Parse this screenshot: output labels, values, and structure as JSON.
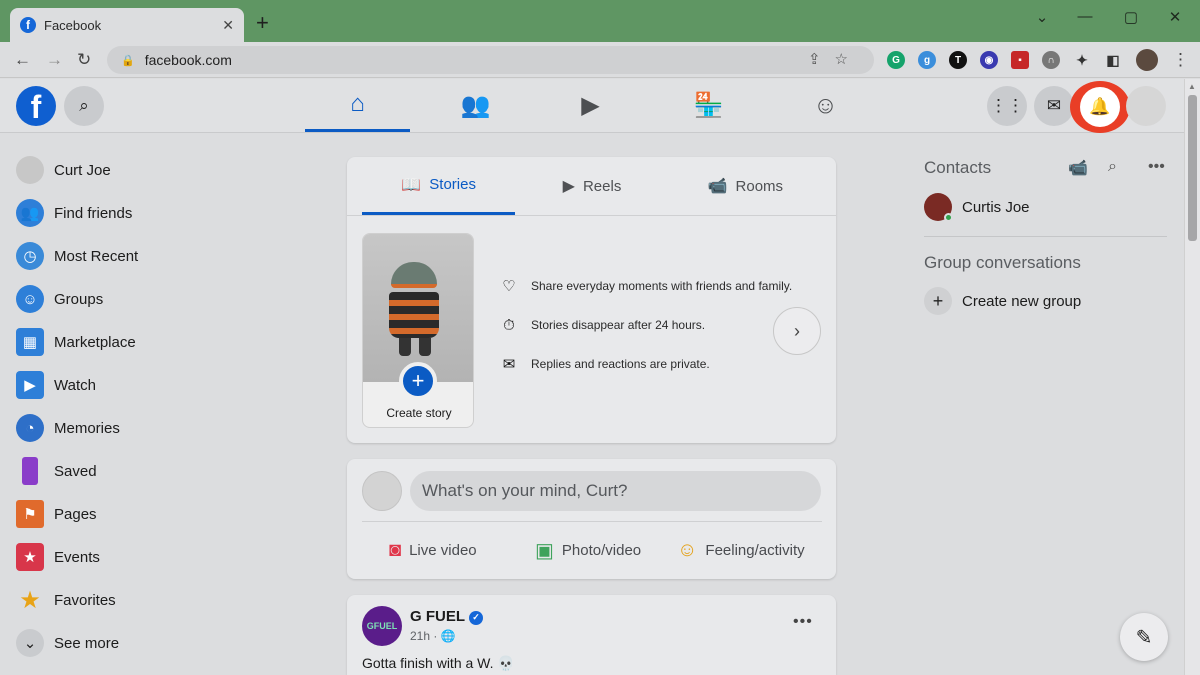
{
  "browser": {
    "tab_title": "Facebook",
    "tab_favicon": "f",
    "tab_close": "✕",
    "new_tab": "+",
    "url": "facebook.com",
    "window_controls": [
      "⌄",
      "—",
      "▢",
      "✕"
    ]
  },
  "header": {
    "logo": "f",
    "icons": {
      "search": "search-icon",
      "home": "home-icon",
      "friends": "friends-icon",
      "watch": "watch-icon",
      "marketplace": "marketplace-icon",
      "groups": "groups-icon",
      "menu": "menu-grid-icon",
      "messenger": "messenger-icon",
      "notifications": "bell-icon",
      "account": "avatar"
    },
    "highlight_color": "#e93e26"
  },
  "left_nav": [
    {
      "label": "Curt Joe",
      "icon": "avatar-icon"
    },
    {
      "label": "Find friends",
      "icon": "friends-icon"
    },
    {
      "label": "Most Recent",
      "icon": "most-recent-icon"
    },
    {
      "label": "Groups",
      "icon": "groups-icon"
    },
    {
      "label": "Marketplace",
      "icon": "marketplace-icon"
    },
    {
      "label": "Watch",
      "icon": "watch-icon"
    },
    {
      "label": "Memories",
      "icon": "memories-icon"
    },
    {
      "label": "Saved",
      "icon": "saved-icon"
    },
    {
      "label": "Pages",
      "icon": "pages-icon"
    },
    {
      "label": "Events",
      "icon": "events-icon"
    },
    {
      "label": "Favorites",
      "icon": "favorites-icon"
    },
    {
      "label": "See more",
      "icon": "chevron-down-icon"
    }
  ],
  "stories": {
    "tabs": [
      "Stories",
      "Reels",
      "Rooms"
    ],
    "active_tab": "Stories",
    "create_label": "Create story",
    "lines": [
      "Share everyday moments with friends and family.",
      "Stories disappear after 24 hours.",
      "Replies and reactions are private."
    ]
  },
  "composer": {
    "placeholder": "What's on your mind, Curt?",
    "actions": [
      "Live video",
      "Photo/video",
      "Feeling/activity"
    ]
  },
  "post": {
    "author": "G FUEL",
    "avatar_text": "GFUEL",
    "time": "21h",
    "text": "Gotta finish with a W. 💀"
  },
  "right": {
    "contacts_heading": "Contacts",
    "contact_name": "Curtis Joe",
    "group_heading": "Group conversations",
    "create_group": "Create new group"
  },
  "colors": {
    "fb_blue": "#0b5bc4",
    "tabstrip_green": "#5f9663"
  }
}
